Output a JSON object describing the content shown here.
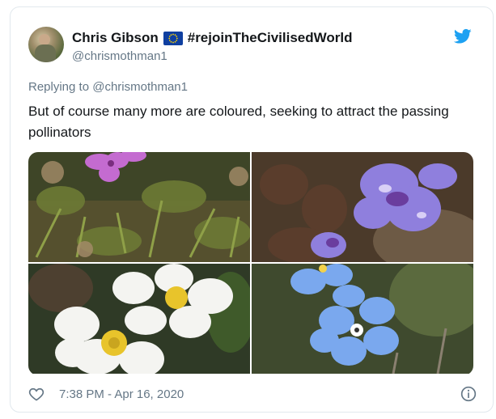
{
  "author": {
    "display_name": "Chris Gibson",
    "flag_icon": "eu-flag-icon",
    "hashtag": "#rejoinTheCivilisedWorld",
    "handle": "@chrismothman1"
  },
  "tweet": {
    "replying_prefix": "Replying to",
    "replying_to": "@chrismothman1",
    "text": "But of course many more are coloured, seeking to attract the passing pollinators"
  },
  "footer": {
    "timestamp": "7:38 PM - Apr 16, 2020"
  },
  "colors": {
    "brand_blue": "#1da1f2",
    "secondary_text": "#657786"
  },
  "icons": [
    "twitter-bird-icon",
    "heart-icon",
    "info-icon"
  ]
}
